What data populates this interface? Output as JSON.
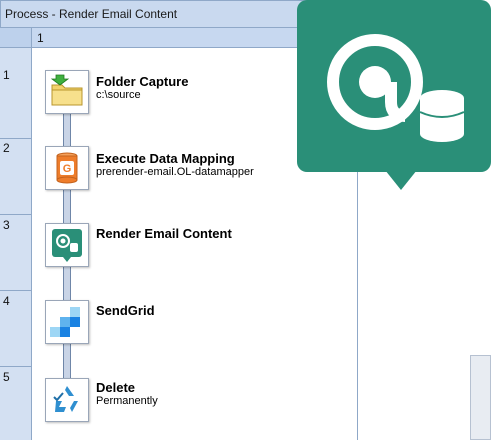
{
  "window": {
    "title": "Process - Render Email Content"
  },
  "grid": {
    "column_header": "1",
    "rows": [
      "1",
      "2",
      "3",
      "4",
      "5"
    ]
  },
  "steps": [
    {
      "icon": "folder-capture-icon",
      "title": "Folder Capture",
      "subtitle": "c:\\source"
    },
    {
      "icon": "data-mapping-icon",
      "title": "Execute Data Mapping",
      "subtitle": "prerender-email.OL-datamapper"
    },
    {
      "icon": "render-email-icon",
      "title": "Render Email Content",
      "subtitle": ""
    },
    {
      "icon": "sendgrid-icon",
      "title": "SendGrid",
      "subtitle": ""
    },
    {
      "icon": "delete-icon",
      "title": "Delete",
      "subtitle": "Permanently"
    }
  ],
  "callout": {
    "icon": "at-database-icon",
    "color": "#2a8f78"
  },
  "colors": {
    "accent": "#2a8f78",
    "header": "#c9d9ef",
    "gutter": "#d3e0f2"
  }
}
